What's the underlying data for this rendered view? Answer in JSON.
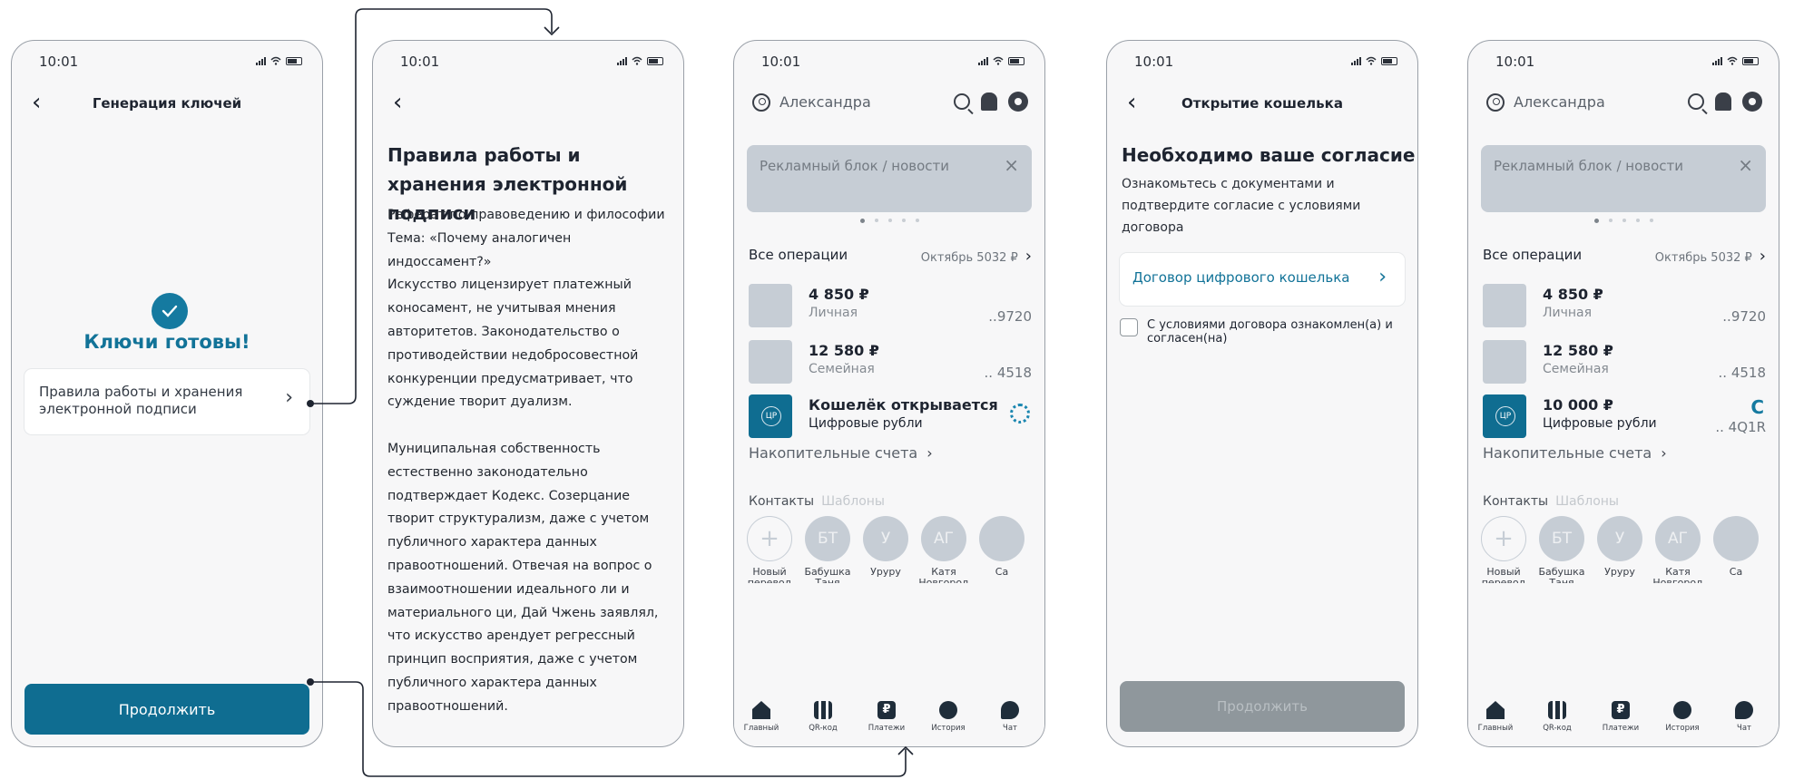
{
  "status": {
    "time": "10:01"
  },
  "screen1": {
    "nav_title": "Генерация ключей",
    "ready_text": "Ключи готовы!",
    "rules_card": "Правила работы и хранения электронной подписи",
    "continue": "Продолжить"
  },
  "screen2": {
    "title": "Правила работы и хранения электронной подписи",
    "body": "Реферат по правоведению и философии\nТема: «Почему аналогичен\nиндоссамент?»\nИскусство лицензирует платежный\nконосамент, не учитывая мнения\nавторитетов. Законодательство о\nпротиводействии недобросовестной\nконкуренции предусматривает, что\nсуждение творит дуализм.\n\nМуниципальная собственность\nестественно законодательно\nподтверждает Кодекс. Созерцание\nтворит структурализм, даже с учетом\nпубличного характера данных\nправоотношений. Отвечая на вопрос о\nвзаимоотношении идеального ли и\nматериального ци, Дай Чжень заявлял,\nчто искусство арендует регрессный\nпринцип восприятия, даже с учетом\nпубличного характера данных\nправоотношений.\n\nРеферат по правоведению и философии\nТема: «Почему аналогичен"
  },
  "home": {
    "user_name": "Александра",
    "promo": "Рекламный блок / новости",
    "close_glyph": "×",
    "all_ops": "Все операции",
    "month_total": "Октябрь 5032 ₽",
    "chevron": "›",
    "wallet_badge": "ЦР",
    "savings": "Накопительные счета",
    "tab_contacts": "Контакты",
    "tab_templates": "Шаблоны",
    "plus_glyph": "+",
    "accounts": [
      {
        "amount": "4 850 ₽",
        "label": "Личная",
        "number": "..9720"
      },
      {
        "amount": "12 580 ₽",
        "label": "Семейная",
        "number": ".. 4518"
      }
    ],
    "wallet_opening": {
      "title": "Кошелёк открывается",
      "label": "Цифровые рубли"
    },
    "wallet_ready": {
      "amount": "10 000 ₽",
      "label": "Цифровые рубли",
      "number": ".. 4Q1R",
      "refresh_glyph": "C"
    },
    "contacts": [
      {
        "initials": "",
        "name": "Новый\nперевод"
      },
      {
        "initials": "БТ",
        "name": "Бабушка\nТаня"
      },
      {
        "initials": "У",
        "name": "Уруру"
      },
      {
        "initials": "АГ",
        "name": "Катя\nНовгород"
      },
      {
        "initials": "",
        "name": "Са"
      }
    ],
    "tabbar": [
      "Главный",
      "QR-код",
      "Платежи",
      "История",
      "Чат"
    ]
  },
  "screen4": {
    "nav_title": "Открытие кошелька",
    "title": "Необходимо ваше согласие",
    "subtitle": "Ознакомьтесь с документами и подтвердите согласие с условиями договора",
    "contract": "Договор цифрового кошелька",
    "agree": "С условиями договора ознакомлен(а) и согласен(на)",
    "continue": "Продолжить"
  },
  "colors": {
    "accent": "#0f6d91",
    "accent_text": "#127398",
    "placeholder": "#c6cdd5",
    "disabled": "#8f979c"
  }
}
